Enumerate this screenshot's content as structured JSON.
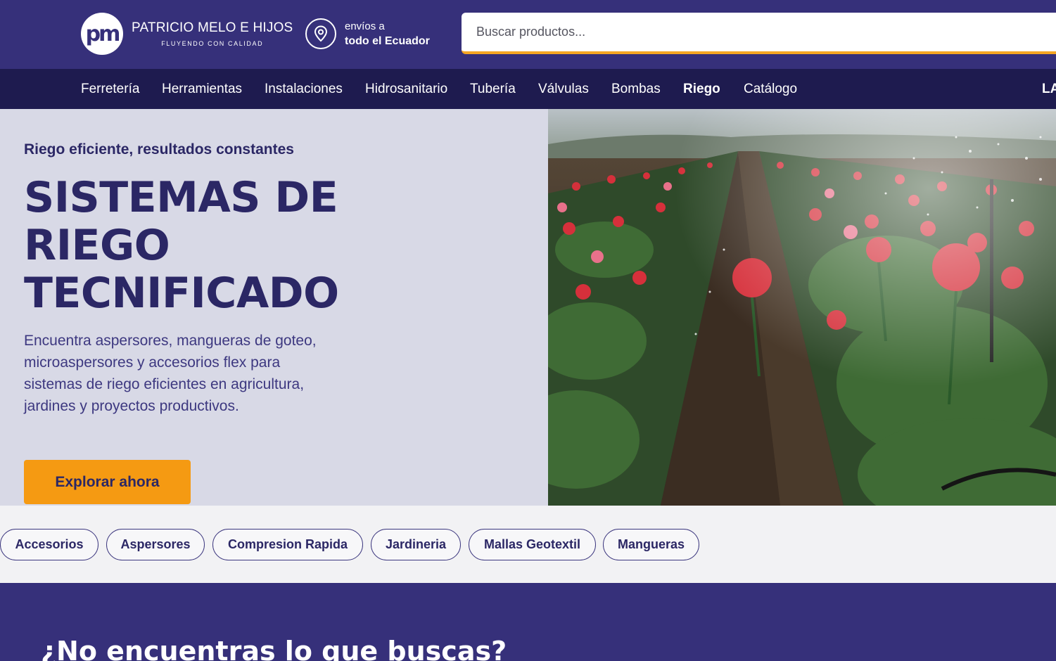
{
  "header": {
    "logo": {
      "monogram": "pm",
      "name": "PATRICIO MELO E HIJOS",
      "tagline": "FLUYENDO CON CALIDAD"
    },
    "shipping": {
      "icon": "location-pin-icon",
      "line1": "envíos a",
      "line2": "todo el Ecuador"
    },
    "search": {
      "placeholder": "Buscar productos..."
    }
  },
  "nav": {
    "items": [
      "Ferretería",
      "Herramientas",
      "Instalaciones",
      "Hidrosanitario",
      "Tubería",
      "Válvulas",
      "Bombas",
      "Riego",
      "Catálogo"
    ],
    "active": "Riego",
    "language_partial": "LA"
  },
  "hero": {
    "kicker": "Riego eficiente, resultados constantes",
    "title_lines": [
      "SISTEMAS DE",
      "RIEGO",
      "TECNIFICADO"
    ],
    "description": "Encuentra aspersores, mangueras de goteo, microaspersores y accesorios flex para sistemas de riego eficientes en agricultura, jardines y proyectos productivos.",
    "cta": "Explorar ahora"
  },
  "categories": [
    "Accesorios",
    "Aspersores",
    "Compresion Rapida",
    "Jardineria",
    "Mallas Geotextil",
    "Mangueras"
  ],
  "footer": {
    "title": "¿No encuentras lo que buscas?"
  },
  "colors": {
    "brand": "#36307a",
    "nav": "#1e1b4f",
    "accent": "#f59a12",
    "hero_bg": "#d8d9e6"
  }
}
